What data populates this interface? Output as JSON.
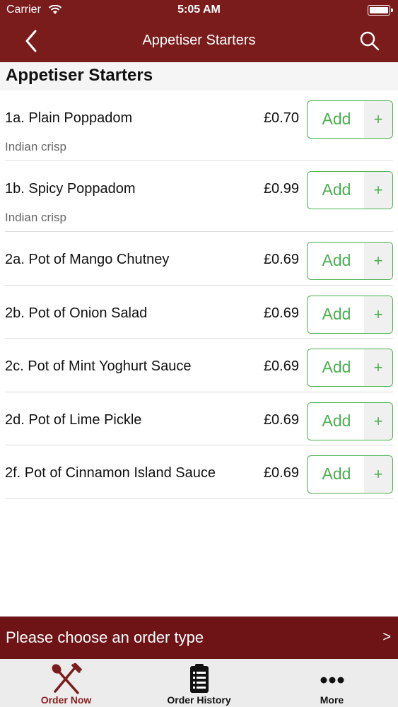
{
  "status_bar": {
    "carrier": "Carrier",
    "time": "5:05 AM"
  },
  "nav": {
    "title": "Appetiser Starters"
  },
  "section": {
    "title": "Appetiser Starters"
  },
  "add_button": {
    "label": "Add",
    "plus": "+"
  },
  "items": [
    {
      "name": "1a. Plain Poppadom",
      "price": "£0.70",
      "description": "Indian crisp"
    },
    {
      "name": "1b. Spicy Poppadom",
      "price": "£0.99",
      "description": "Indian crisp"
    },
    {
      "name": "2a. Pot of Mango Chutney",
      "price": "£0.69"
    },
    {
      "name": "2b. Pot of Onion Salad",
      "price": "£0.69"
    },
    {
      "name": "2c. Pot of Mint Yoghurt Sauce",
      "price": "£0.69"
    },
    {
      "name": "2d. Pot of Lime Pickle",
      "price": "£0.69"
    },
    {
      "name": "2f. Pot of Cinnamon Island Sauce",
      "price": "£0.69"
    }
  ],
  "order_bar": {
    "text": "Please choose an order type",
    "chevron": ">"
  },
  "tabs": [
    {
      "label": "Order Now",
      "icon": "fork-spoon-icon",
      "active": true
    },
    {
      "label": "Order History",
      "icon": "clipboard-list-icon",
      "active": false
    },
    {
      "label": "More",
      "icon": "more-dots-icon",
      "active": false
    }
  ],
  "colors": {
    "brand": "#7a1c1c",
    "order_bar": "#6e1417",
    "accent_green": "#4caf50",
    "active_tab": "#8b1c1c"
  }
}
